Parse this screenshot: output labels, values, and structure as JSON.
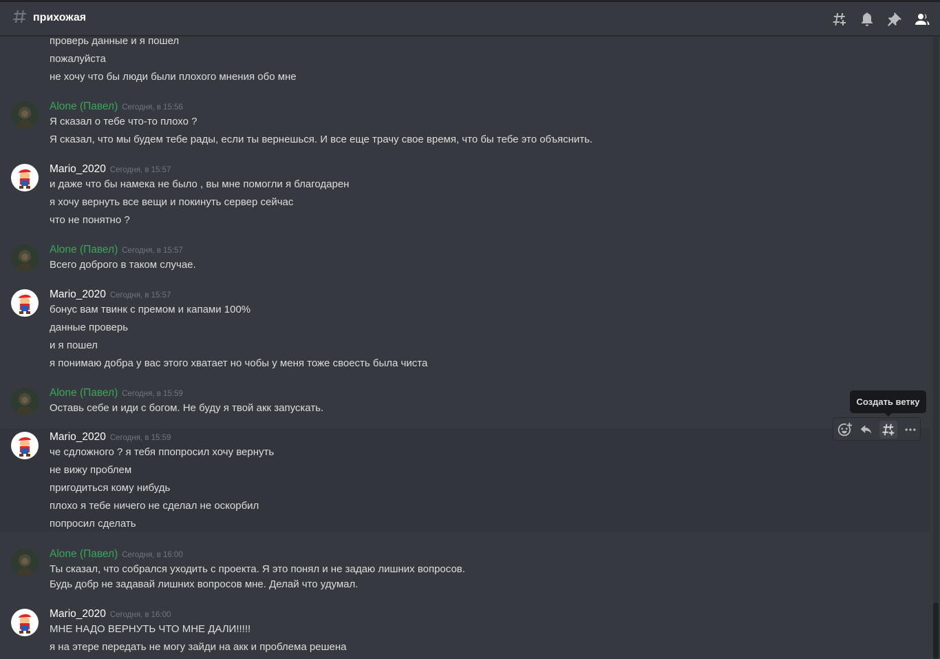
{
  "channel": {
    "name": "прихожая"
  },
  "top_icons": [
    "threads-icon",
    "bell-icon",
    "pin-icon",
    "members-icon"
  ],
  "tooltip": "Создать ветку",
  "action_bar": [
    "add-reaction-icon",
    "reply-icon",
    "create-thread-icon",
    "more-icon"
  ],
  "messages": [
    {
      "lines": [
        "проверь данные и я пошел",
        "пожалуйста",
        "не хочу что бы люди были плохого мнения обо мне"
      ]
    },
    {
      "author": "Alone (Павел)",
      "time": "Сегодня, в 15:56",
      "lines": [
        "Я сказал о тебе что-то плохо ?",
        "Я сказал, что мы будем тебе рады, если ты вернешься. И все еще трачу свое время, что бы тебе это объяснить."
      ]
    },
    {
      "author": "Mario_2020",
      "time": "Сегодня, в 15:57",
      "lines": [
        "и даже что бы намека не было , вы мне помогли я благодарен",
        "я хочу вернуть все вещи и покинуть сервер сейчас",
        "что не понятно ?"
      ]
    },
    {
      "author": "Alone (Павел)",
      "time": "Сегодня, в 15:57",
      "lines": [
        "Всего доброго в таком случае."
      ]
    },
    {
      "author": "Mario_2020",
      "time": "Сегодня, в 15:57",
      "lines": [
        "бонус вам твинк с премом и капами 100%",
        "данные проверь",
        "и я пошел",
        "я понимаю добра у вас этого хватает но чобы у меня тоже своесть была чиста"
      ]
    },
    {
      "author": "Alone (Павел)",
      "time": "Сегодня, в 15:59",
      "lines": [
        "Оставь себе и иди с богом. Не буду я твой акк запускать."
      ]
    },
    {
      "author": "Mario_2020",
      "time": "Сегодня, в 15:59",
      "lines": [
        "че сдложного ? я тебя ппопросил хочу вернуть",
        "не вижу проблем",
        "пригодиться кому нибудь",
        "плохо я тебе ничего не сделал не оскорбил",
        "попросил сделать"
      ]
    },
    {
      "author": "Alone (Павел)",
      "time": "Сегодня, в 16:00",
      "lines": [
        "Ты сказал, что собрался уходить с проекта. Я это понял и не задаю лишних вопросов.",
        "Будь добр не задавай лишних вопросов мне. Делай что удумал."
      ]
    },
    {
      "author": "Mario_2020",
      "time": "Сегодня, в 16:00",
      "lines": [
        "МНЕ НАДО ВЕРНУТЬ ЧТО МНЕ ДАЛИ!!!!!",
        "я на этере передать не могу зайди на акк и проблема решена"
      ]
    }
  ]
}
